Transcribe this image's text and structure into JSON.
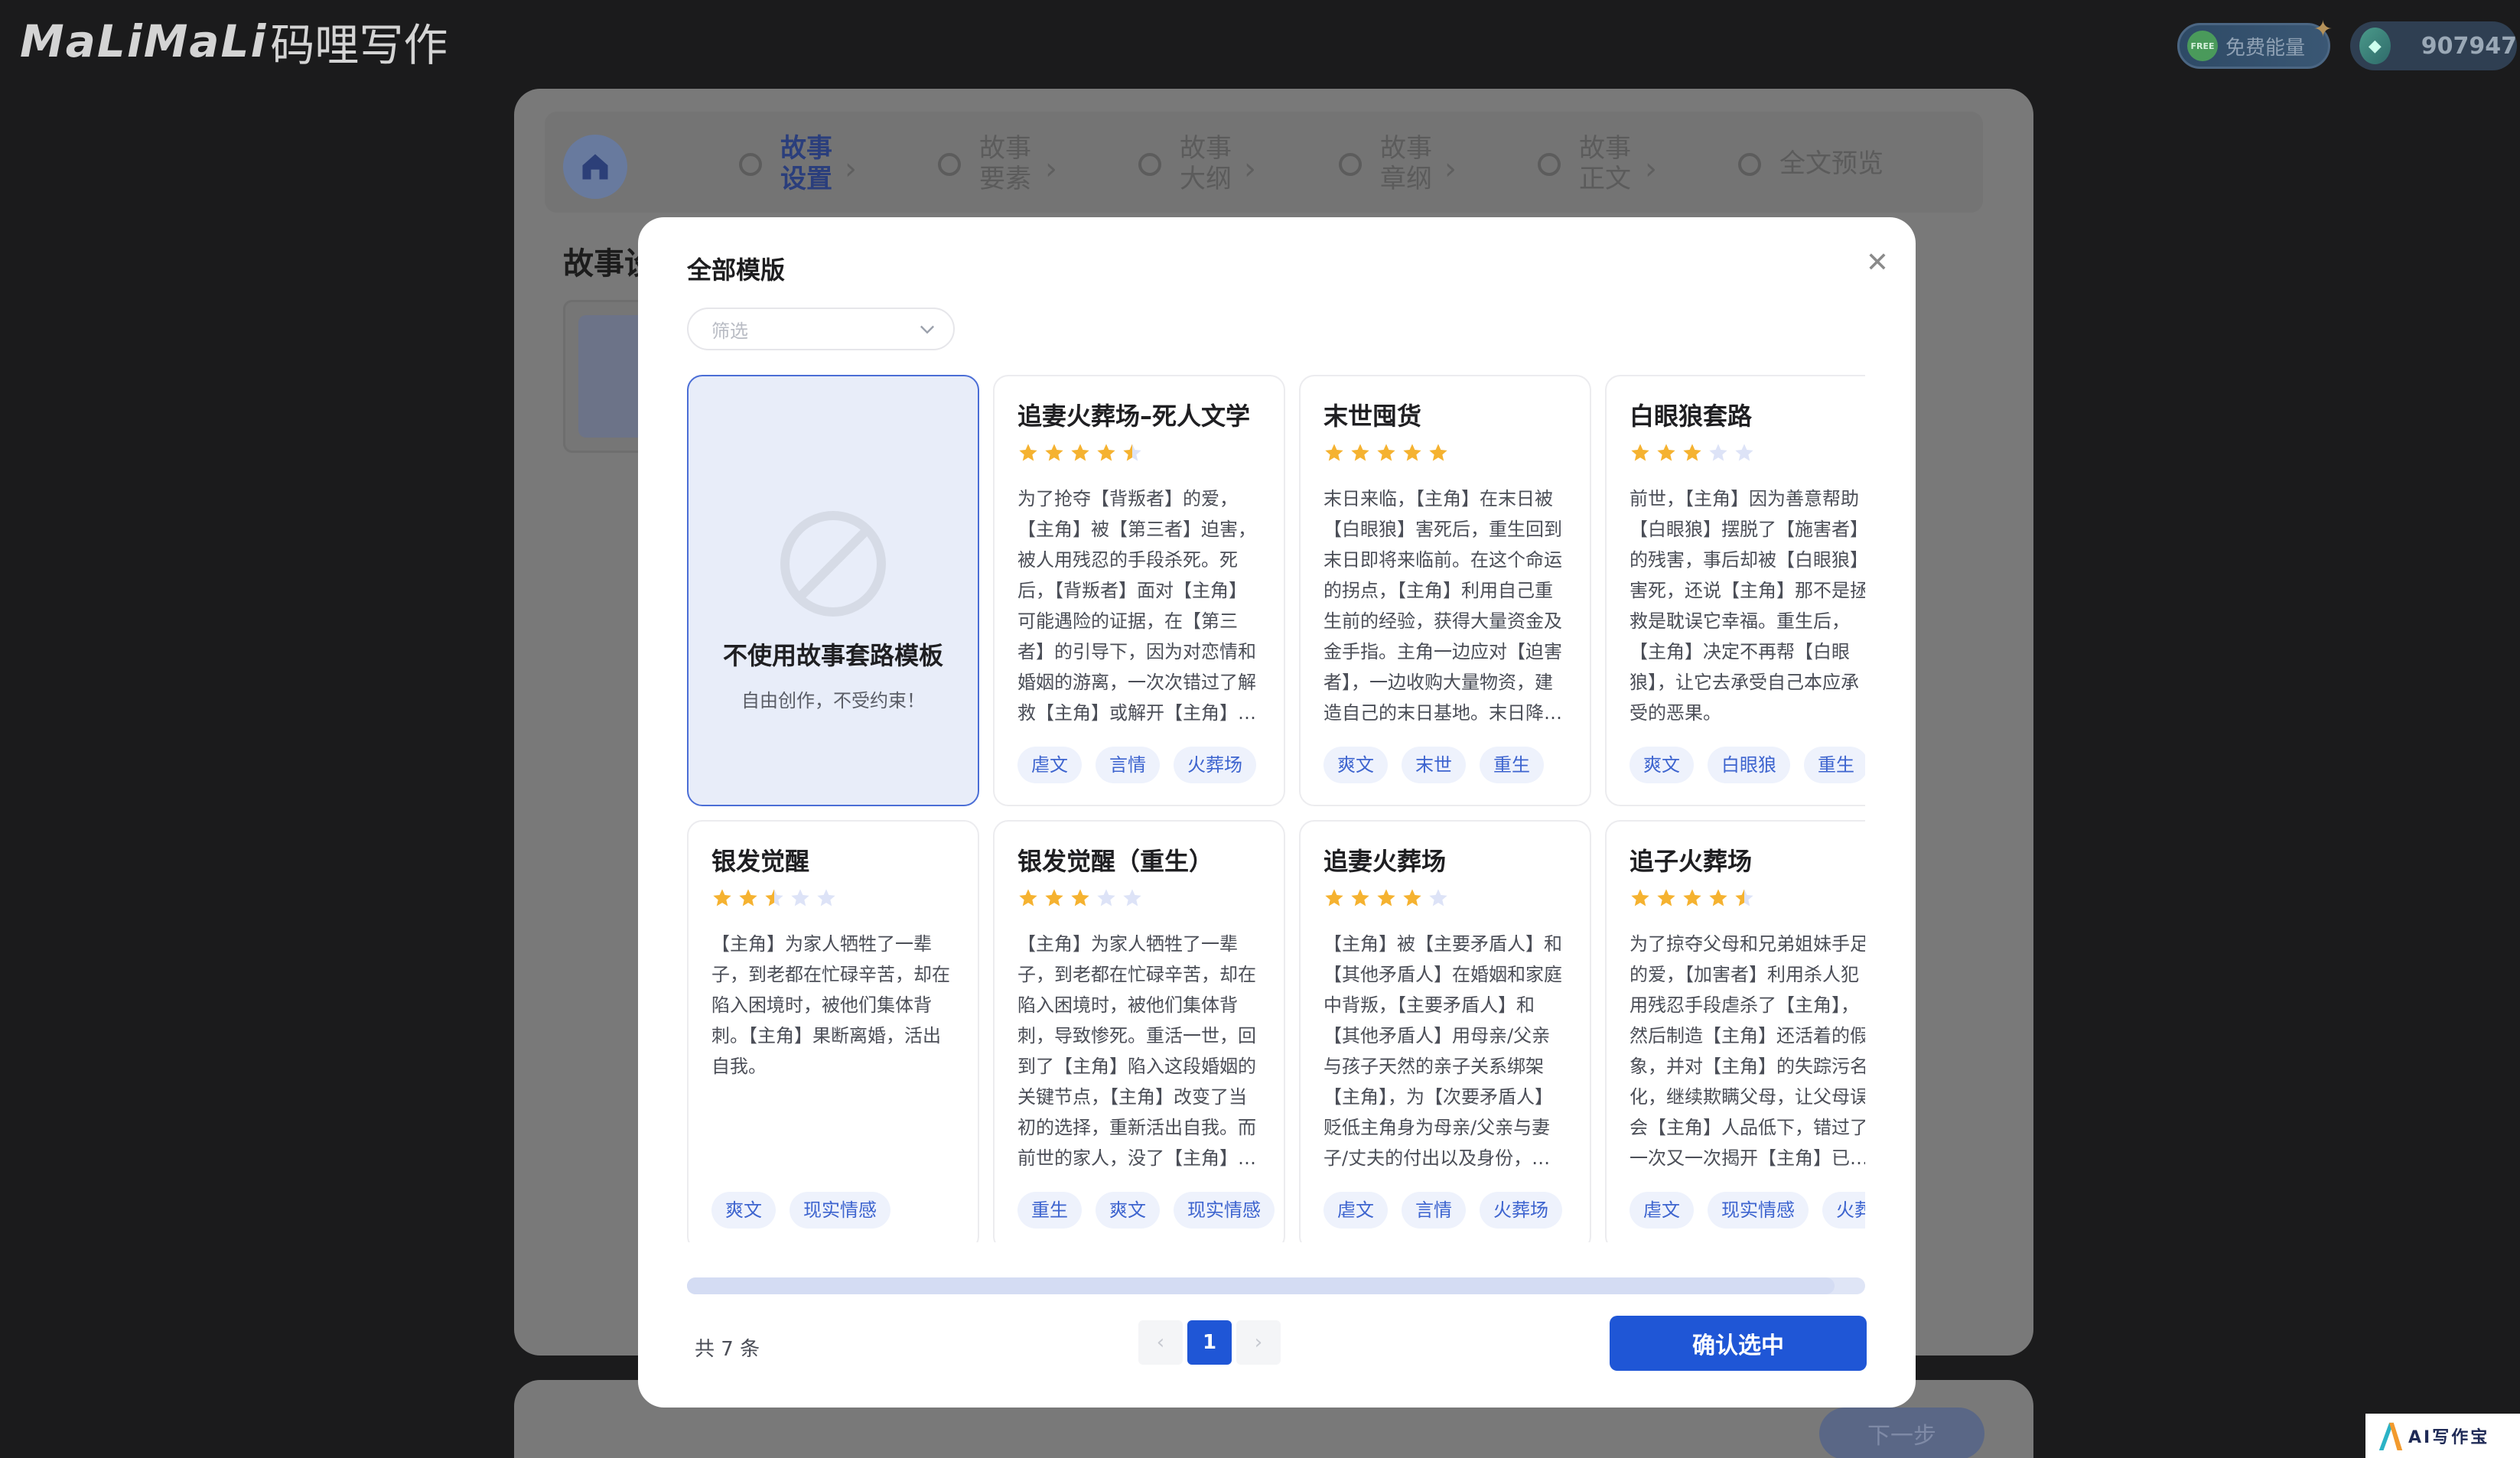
{
  "app": {
    "logo_latin": "MaLiMaLi",
    "logo_cn": "码哩写作",
    "energy_free_badge": "FREE",
    "energy_label": "免费能量",
    "coin_balance": "907947"
  },
  "background": {
    "steps": [
      {
        "label": "故事设置",
        "active": true
      },
      {
        "label": "故事要素",
        "active": false
      },
      {
        "label": "故事大纲",
        "active": false
      },
      {
        "label": "故事章纲",
        "active": false
      },
      {
        "label": "故事正文",
        "active": false
      },
      {
        "label": "全文预览",
        "active": false
      }
    ],
    "section_title": "故事设",
    "next_label": "下一步"
  },
  "modal": {
    "title": "全部模版",
    "filter_placeholder": "筛选",
    "no_template": {
      "title": "不使用故事套路模板",
      "subtitle": "自由创作，不受约束！"
    },
    "cards": [
      {
        "title": "追妻火葬场–死人文学",
        "rating": 4.5,
        "desc": "为了抢夺【背叛者】的爱，【主角】被【第三者】迫害，被人用残忍的手段杀死。死后，【背叛者】面对【主角】可能遇险的证据，在【第三者】的引导下，因为对恋情和婚姻的游离，一次次错过了解救【主角】或解开【主角】…",
        "tags": [
          "虐文",
          "言情",
          "火葬场"
        ]
      },
      {
        "title": "末世囤货",
        "rating": 5,
        "desc": "末日来临，【主角】在末日被【白眼狼】害死后，重生回到末日即将来临前。在这个命运的拐点，【主角】利用自己重生前的经验，获得大量资金及金手指。主角一边应对【迫害者】，一边收购大量物资，建造自己的末日基地。末日降…",
        "tags": [
          "爽文",
          "末世",
          "重生"
        ]
      },
      {
        "title": "白眼狼套路",
        "rating": 3,
        "desc": "前世，【主角】因为善意帮助【白眼狼】摆脱了【施害者】的残害，事后却被【白眼狼】害死，还说【主角】那不是拯救是耽误它幸福。重生后，【主角】决定不再帮【白眼狼】，让它去承受自己本应承受的恶果。",
        "tags": [
          "爽文",
          "白眼狼",
          "重生"
        ]
      },
      {
        "title": "银发觉醒",
        "rating": 2.5,
        "desc": "【主角】为家人牺牲了一辈子，到老都在忙碌辛苦，却在陷入困境时，被他们集体背刺。【主角】果断离婚，活出自我。",
        "tags": [
          "爽文",
          "现实情感"
        ]
      },
      {
        "title": "银发觉醒（重生）",
        "rating": 3,
        "desc": "【主角】为家人牺牲了一辈子，到老都在忙碌辛苦，却在陷入困境时，被他们集体背刺，导致惨死。重活一世，回到了【主角】陷入这段婚姻的关键节点，【主角】改变了当初的选择，重新活出自我。而前世的家人，没了【主角】…",
        "tags": [
          "重生",
          "爽文",
          "现实情感"
        ]
      },
      {
        "title": "追妻火葬场",
        "rating": 4,
        "desc": "【主角】被【主要矛盾人】和【其他矛盾人】在婚姻和家庭中背叛，【主要矛盾人】和【其他矛盾人】用母亲/父亲与孩子天然的亲子关系绑架【主角】，为【次要矛盾人】贬低主角身为母亲/父亲与妻子/丈夫的付出以及身份，…",
        "tags": [
          "虐文",
          "言情",
          "火葬场"
        ]
      },
      {
        "title": "追子火葬场",
        "rating": 4.5,
        "desc": "为了掠夺父母和兄弟姐妹手足的爱，【加害者】利用杀人犯用残忍手段虐杀了【主角】，然后制造【主角】还活着的假象，并对【主角】的失踪污名化，继续欺瞒父母，让父母误会【主角】人品低下，错过了一次又一次揭开【主角】已…",
        "tags": [
          "虐文",
          "现实情感",
          "火葬场"
        ]
      }
    ],
    "pagination": {
      "total_label": "共 7 条",
      "prev": "‹",
      "current": "1",
      "next": "›"
    },
    "confirm_label": "确认选中"
  },
  "watermark": "AI写作宝",
  "colors": {
    "accent": "#1f56d6",
    "star_on": "#f5b230",
    "star_off": "#dde3f7",
    "tag_bg": "#eef2fc",
    "tag_text": "#3d64cf"
  }
}
